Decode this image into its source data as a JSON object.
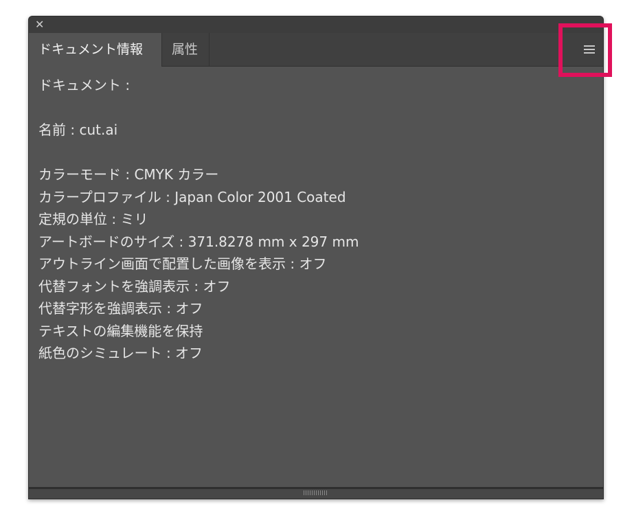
{
  "window": {
    "close_glyph": "✕"
  },
  "tabs": [
    {
      "label": "ドキュメント情報",
      "active": true
    },
    {
      "label": "属性",
      "active": false
    }
  ],
  "menu": {
    "icon": "hamburger-menu-icon"
  },
  "document_info": {
    "heading": "ドキュメント :",
    "name_line": "名前 : cut.ai",
    "lines": [
      "カラーモード : CMYK カラー",
      "カラープロファイル : Japan Color 2001 Coated",
      "定規の単位 : ミリ",
      "アートボードのサイズ : 371.8278 mm x 297 mm",
      "アウトライン画面で配置した画像を表示 : オフ",
      "代替フォントを強調表示 : オフ",
      "代替字形を強調表示 : オフ",
      "テキストの編集機能を保持",
      "紙色のシミュレート : オフ"
    ]
  },
  "colors": {
    "panel_bg": "#535353",
    "tab_bar_bg": "#404040",
    "text": "#e6e6e6",
    "highlight": "#e0115b"
  }
}
